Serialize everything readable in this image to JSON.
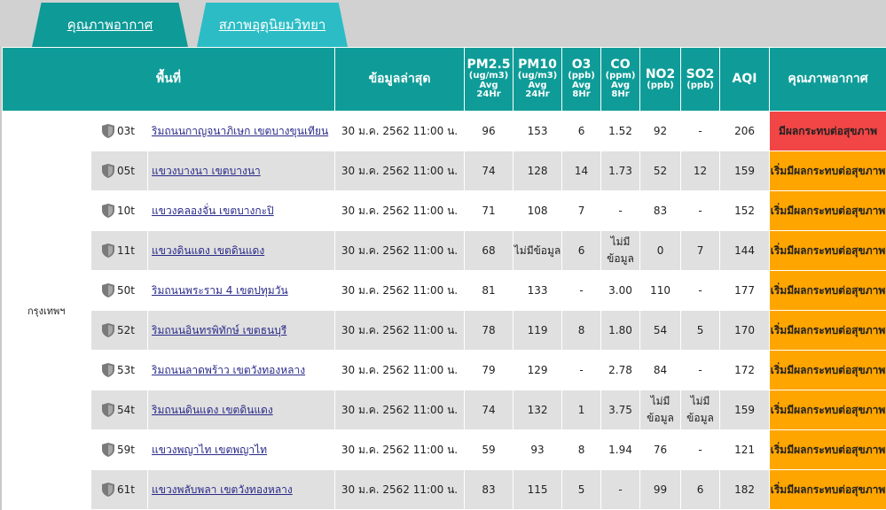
{
  "tabs": {
    "active": "คุณภาพอากาศ",
    "inactive": "สภาพอุตุนิยมวิทยา"
  },
  "headers": {
    "area": "พื้นที่",
    "latest": "ข้อมูลล่าสุด",
    "pm25": "PM2.5",
    "pm25_sub1": "(ug/m3)",
    "pm25_sub2": "Avg",
    "pm25_sub3": "24Hr",
    "pm10": "PM10",
    "pm10_sub1": "(ug/m3)",
    "pm10_sub2": "Avg",
    "pm10_sub3": "24Hr",
    "o3": "O3",
    "o3_sub1": "(ppb)",
    "o3_sub2": "Avg",
    "o3_sub3": "8Hr",
    "co": "CO",
    "co_sub1": "(ppm)",
    "co_sub2": "Avg",
    "co_sub3": "8Hr",
    "no2": "NO2",
    "no2_sub1": "(ppb)",
    "so2": "SO2",
    "so2_sub1": "(ppb)",
    "aqi": "AQI",
    "quality": "คุณภาพอากาศ"
  },
  "region": "กรุงเทพฯ",
  "rows": [
    {
      "code": "03t",
      "area": "ริมถนนกาญจนาภิเษก เขตบางขุนเทียน",
      "time": "30 ม.ค. 2562 11:00 น.",
      "pm25": "96",
      "pm10": "153",
      "o3": "6",
      "co": "1.52",
      "no2": "92",
      "so2": "-",
      "aqi": "206",
      "status": "มีผลกระทบต่อสุขภาพ",
      "level": "high"
    },
    {
      "code": "05t",
      "area": "แขวงบางนา เขตบางนา",
      "time": "30 ม.ค. 2562 11:00 น.",
      "pm25": "74",
      "pm10": "128",
      "o3": "14",
      "co": "1.73",
      "no2": "52",
      "so2": "12",
      "aqi": "159",
      "status": "เริ่มมีผลกระทบต่อสุขภาพ",
      "level": "mod"
    },
    {
      "code": "10t",
      "area": "แขวงคลองจั่น เขตบางกะปิ",
      "time": "30 ม.ค. 2562 11:00 น.",
      "pm25": "71",
      "pm10": "108",
      "o3": "7",
      "co": "-",
      "no2": "83",
      "so2": "-",
      "aqi": "152",
      "status": "เริ่มมีผลกระทบต่อสุขภาพ",
      "level": "mod"
    },
    {
      "code": "11t",
      "area": "แขวงดินแดง เขตดินแดง",
      "time": "30 ม.ค. 2562 11:00 น.",
      "pm25": "68",
      "pm10": "ไม่มีข้อมูล",
      "o3": "6",
      "co": "ไม่มีข้อมูล",
      "no2": "0",
      "so2": "7",
      "aqi": "144",
      "status": "เริ่มมีผลกระทบต่อสุขภาพ",
      "level": "mod"
    },
    {
      "code": "50t",
      "area": "ริมถนนพระราม 4 เขตปทุมวัน",
      "time": "30 ม.ค. 2562 11:00 น.",
      "pm25": "81",
      "pm10": "133",
      "o3": "-",
      "co": "3.00",
      "no2": "110",
      "so2": "-",
      "aqi": "177",
      "status": "เริ่มมีผลกระทบต่อสุขภาพ",
      "level": "mod"
    },
    {
      "code": "52t",
      "area": "ริมถนนอินทรพิทักษ์ เขตธนบุรี",
      "time": "30 ม.ค. 2562 11:00 น.",
      "pm25": "78",
      "pm10": "119",
      "o3": "8",
      "co": "1.80",
      "no2": "54",
      "so2": "5",
      "aqi": "170",
      "status": "เริ่มมีผลกระทบต่อสุขภาพ",
      "level": "mod"
    },
    {
      "code": "53t",
      "area": "ริมถนนลาดพร้าว เขตวังทองหลาง",
      "time": "30 ม.ค. 2562 11:00 น.",
      "pm25": "79",
      "pm10": "129",
      "o3": "-",
      "co": "2.78",
      "no2": "84",
      "so2": "-",
      "aqi": "172",
      "status": "เริ่มมีผลกระทบต่อสุขภาพ",
      "level": "mod"
    },
    {
      "code": "54t",
      "area": "ริมถนนดินแดง เขตดินแดง",
      "time": "30 ม.ค. 2562 11:00 น.",
      "pm25": "74",
      "pm10": "132",
      "o3": "1",
      "co": "3.75",
      "no2": "ไม่มีข้อมูล",
      "so2": "ไม่มีข้อมูล",
      "aqi": "159",
      "status": "เริ่มมีผลกระทบต่อสุขภาพ",
      "level": "mod"
    },
    {
      "code": "59t",
      "area": "แขวงพญาไท เขตพญาไท",
      "time": "30 ม.ค. 2562 11:00 น.",
      "pm25": "59",
      "pm10": "93",
      "o3": "8",
      "co": "1.94",
      "no2": "76",
      "so2": "-",
      "aqi": "121",
      "status": "เริ่มมีผลกระทบต่อสุขภาพ",
      "level": "mod"
    },
    {
      "code": "61t",
      "area": "แขวงพลับพลา เขตวังทองหลาง",
      "time": "30 ม.ค. 2562 11:00 น.",
      "pm25": "83",
      "pm10": "115",
      "o3": "5",
      "co": "-",
      "no2": "99",
      "so2": "6",
      "aqi": "182",
      "status": "เริ่มมีผลกระทบต่อสุขภาพ",
      "level": "mod"
    }
  ],
  "colors": {
    "header": "#0f9c98",
    "high": "#f24545",
    "moderate": "#ffa500"
  },
  "icons": {
    "station": "shield-icon"
  }
}
